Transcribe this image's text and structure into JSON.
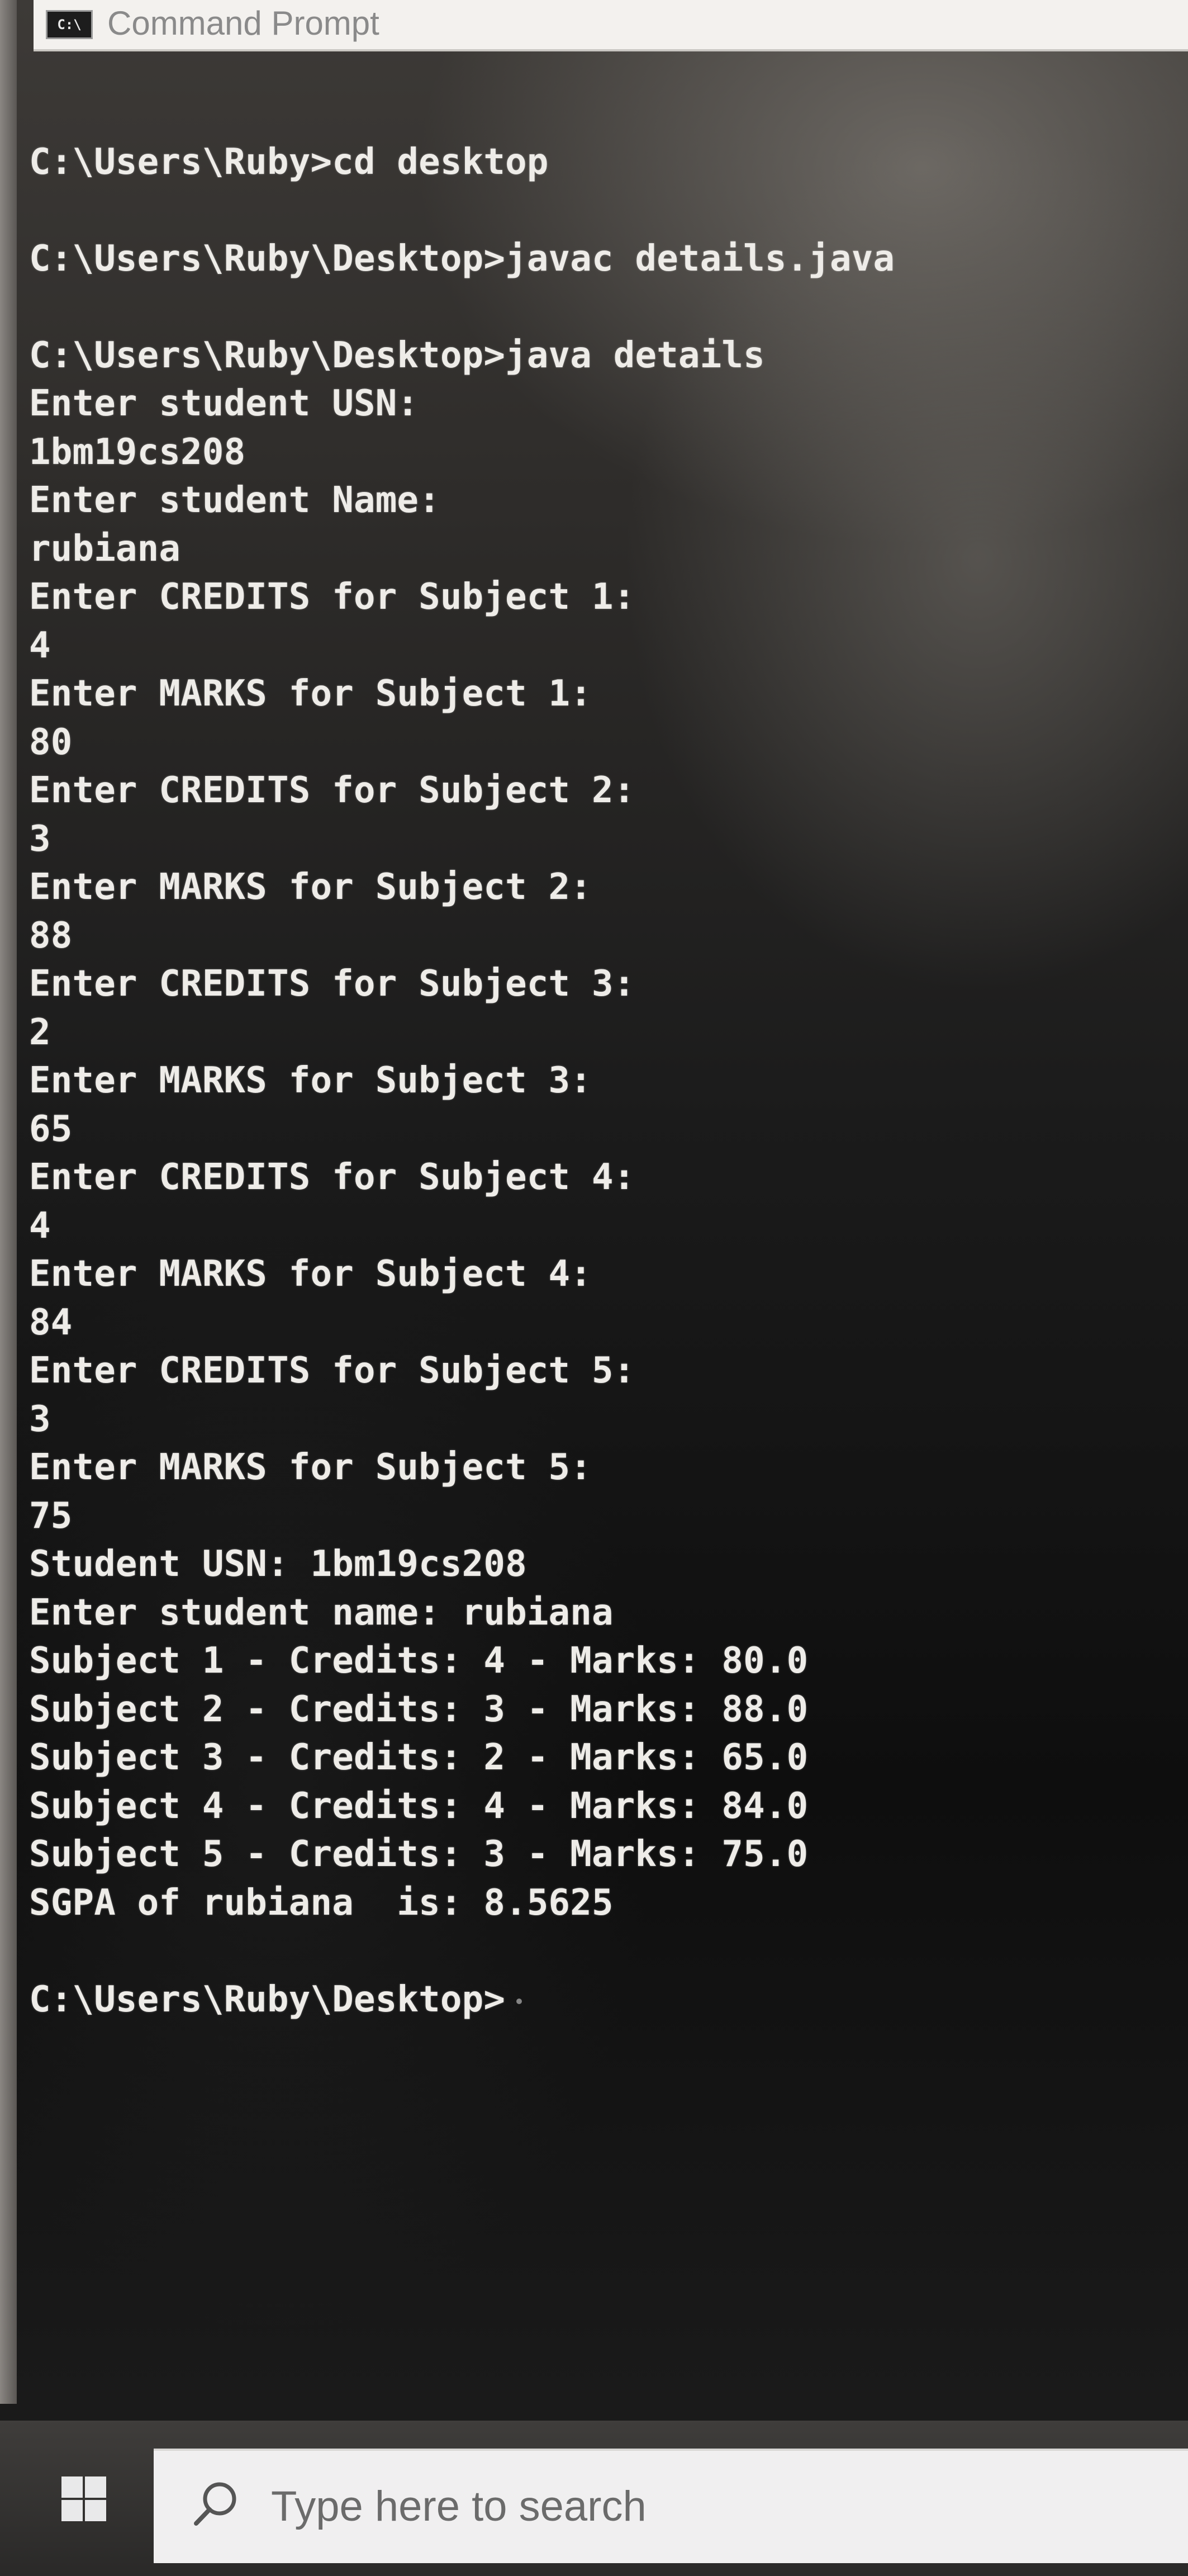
{
  "window": {
    "title": "Command Prompt",
    "icon_label": "C:\\",
    "icon": "cmd-icon"
  },
  "console": {
    "commands": [
      "C:\\Users\\Ruby>cd desktop",
      "C:\\Users\\Ruby\\Desktop>javac details.java",
      "C:\\Users\\Ruby\\Desktop>java details"
    ],
    "session": [
      "Enter student USN:",
      "1bm19cs208",
      "Enter student Name:",
      "rubiana",
      "Enter CREDITS for Subject 1:",
      "4",
      "Enter MARKS for Subject 1:",
      "80",
      "Enter CREDITS for Subject 2:",
      "3",
      "Enter MARKS for Subject 2:",
      "88",
      "Enter CREDITS for Subject 3:",
      "2",
      "Enter MARKS for Subject 3:",
      "65",
      "Enter CREDITS for Subject 4:",
      "4",
      "Enter MARKS for Subject 4:",
      "84",
      "Enter CREDITS for Subject 5:",
      "3",
      "Enter MARKS for Subject 5:",
      "75"
    ],
    "output": [
      "Student USN: 1bm19cs208",
      "Enter student name: rubiana",
      "Subject 1 - Credits: 4 - Marks: 80.0",
      "Subject 2 - Credits: 3 - Marks: 88.0",
      "Subject 3 - Credits: 2 - Marks: 65.0",
      "Subject 4 - Credits: 4 - Marks: 84.0",
      "Subject 5 - Credits: 3 - Marks: 75.0",
      "SGPA of rubiana  is: 8.5625"
    ],
    "prompt": "C:\\Users\\Ruby\\Desktop>"
  },
  "taskbar": {
    "start_icon": "windows-logo-icon",
    "search_icon": "search-icon",
    "search_placeholder": "Type here to search"
  },
  "colors": {
    "console_text": "#eeece8",
    "title_bar": "#f3f1ee",
    "taskbar": "#3f3d3b",
    "search_box": "#f0eff0"
  }
}
